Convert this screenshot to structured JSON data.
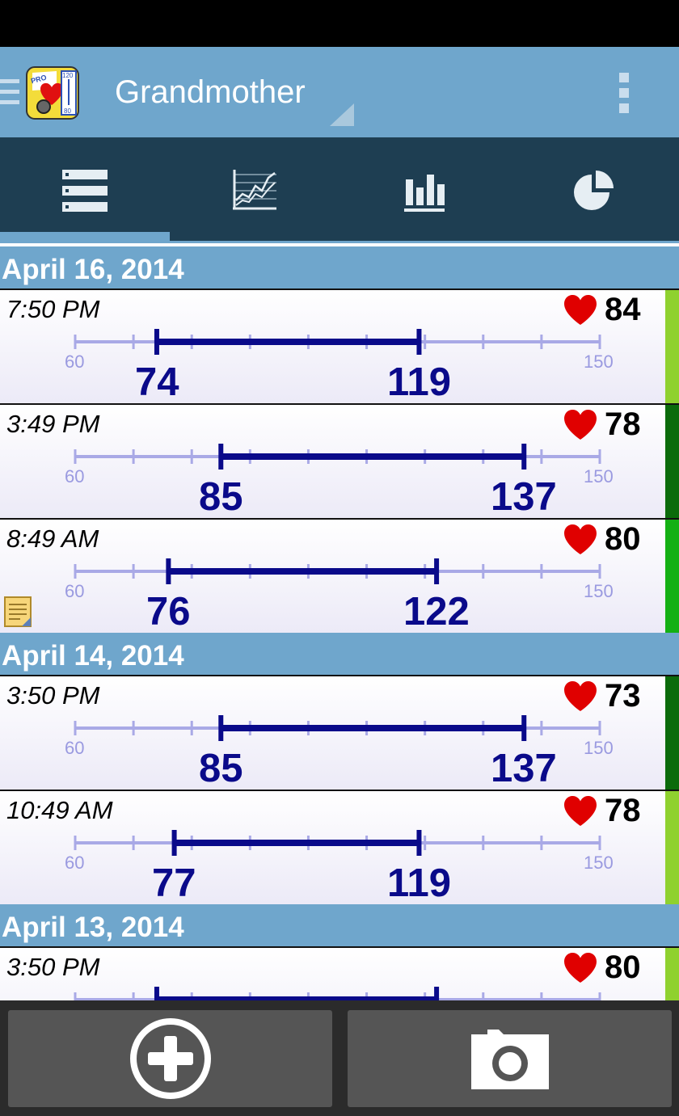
{
  "action_bar": {
    "title": "Grandmother",
    "logo": {
      "badge": "PRO",
      "top_value": "120",
      "bottom_value": "80"
    }
  },
  "tabs": [
    {
      "name": "list-icon",
      "selected": true
    },
    {
      "name": "line-chart-icon",
      "selected": false
    },
    {
      "name": "bar-chart-icon",
      "selected": false
    },
    {
      "name": "pie-chart-icon",
      "selected": false
    }
  ],
  "scale": {
    "min_label": "60",
    "max_label": "150",
    "min": 60,
    "max": 150
  },
  "colors": {
    "accent": "#6fa6cc",
    "tab_bg": "#1e3e52",
    "bar": "#0a0a8a",
    "heart": "#e00000"
  },
  "groups": [
    {
      "date": "April 16, 2014",
      "entries": [
        {
          "time": "7:50 PM",
          "pulse": "84",
          "diastolic": "74",
          "systolic": "119",
          "status_color": "#8fd12f",
          "note": false
        },
        {
          "time": "3:49 PM",
          "pulse": "78",
          "diastolic": "85",
          "systolic": "137",
          "status_color": "#0b6b0b",
          "note": false
        },
        {
          "time": "8:49 AM",
          "pulse": "80",
          "diastolic": "76",
          "systolic": "122",
          "status_color": "#14b014",
          "note": true
        }
      ]
    },
    {
      "date": "April 14, 2014",
      "entries": [
        {
          "time": "3:50 PM",
          "pulse": "73",
          "diastolic": "85",
          "systolic": "137",
          "status_color": "#0b6b0b",
          "note": false
        },
        {
          "time": "10:49 AM",
          "pulse": "78",
          "diastolic": "77",
          "systolic": "119",
          "status_color": "#8fd12f",
          "note": false
        }
      ]
    },
    {
      "date": "April 13, 2014",
      "entries": [
        {
          "time": "3:50 PM",
          "pulse": "80",
          "diastolic": "74",
          "systolic": "122",
          "status_color": "#8fd12f",
          "note": false
        }
      ]
    }
  ],
  "bottom": {
    "add": "add-icon",
    "camera": "camera-icon"
  }
}
